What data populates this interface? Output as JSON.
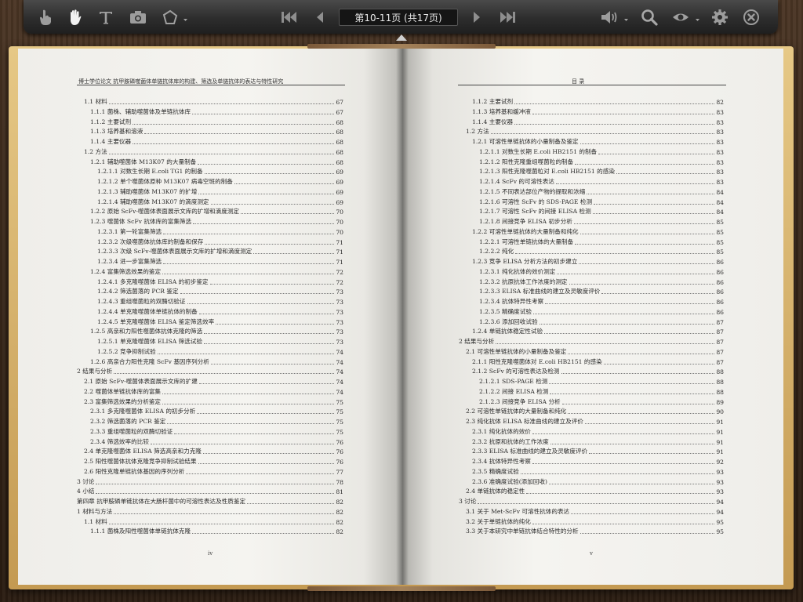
{
  "toolbar": {
    "page_indicator": "第10-11页 (共17页)",
    "tools": [
      {
        "name": "pointer-icon"
      },
      {
        "name": "hand-icon"
      },
      {
        "name": "text-icon"
      },
      {
        "name": "camera-icon"
      },
      {
        "name": "shape-icon"
      },
      {
        "name": "first-page-icon"
      },
      {
        "name": "prev-page-icon"
      },
      {
        "name": "next-page-icon"
      },
      {
        "name": "last-page-icon"
      },
      {
        "name": "volume-icon"
      },
      {
        "name": "search-icon"
      },
      {
        "name": "eye-icon"
      },
      {
        "name": "gear-icon"
      },
      {
        "name": "close-icon"
      }
    ]
  },
  "left_page": {
    "header": "博士学位论文 抗甲胺磷噬菌体单链抗体库的构建、筛选及单链抗体的表达与特性研究",
    "folio": "iv",
    "entries": [
      {
        "level": 2,
        "text": "1.1 材料",
        "page": "67"
      },
      {
        "level": 3,
        "text": "1.1.1 菌株、辅助噬菌体及单链抗体库",
        "page": "67"
      },
      {
        "level": 3,
        "text": "1.1.2 主要试剂",
        "page": "68"
      },
      {
        "level": 3,
        "text": "1.1.3 培养基和溶液",
        "page": "68"
      },
      {
        "level": 3,
        "text": "1.1.4 主要仪器",
        "page": "68"
      },
      {
        "level": 2,
        "text": "1.2 方法",
        "page": "68"
      },
      {
        "level": 3,
        "text": "1.2.1 辅助噬菌体 M13K07 的大量制备",
        "page": "68"
      },
      {
        "level": 4,
        "text": "1.2.1.1 对数生长期 E.coli TG1 的制备",
        "page": "69"
      },
      {
        "level": 4,
        "text": "1.2.1.2 单个噬菌体原种 M13K07 病毒空斑的制备",
        "page": "69"
      },
      {
        "level": 4,
        "text": "1.2.1.3 辅助噬菌体 M13K07 的扩增",
        "page": "69"
      },
      {
        "level": 4,
        "text": "1.2.1.4 辅助噬菌体 M13K07 的滴度测定",
        "page": "69"
      },
      {
        "level": 3,
        "text": "1.2.2 原始 ScFv-噬菌体表面展示文库的扩增和滴度测定",
        "page": "70"
      },
      {
        "level": 3,
        "text": "1.2.3 噬菌体 ScFv 抗体库的富集筛选",
        "page": "70"
      },
      {
        "level": 4,
        "text": "1.2.3.1 第一轮富集筛选",
        "page": "70"
      },
      {
        "level": 4,
        "text": "1.2.3.2 次级噬菌体抗体库的制备和保存",
        "page": "71"
      },
      {
        "level": 4,
        "text": "1.2.3.3 次级 ScFv-噬菌体表面展示文库的扩增和滴度测定",
        "page": "71"
      },
      {
        "level": 4,
        "text": "1.2.3.4 进一步富集筛选",
        "page": "71"
      },
      {
        "level": 3,
        "text": "1.2.4 富集筛选效果的鉴定",
        "page": "72"
      },
      {
        "level": 4,
        "text": "1.2.4.1 多克隆噬菌体 ELISA 的初步鉴定",
        "page": "72"
      },
      {
        "level": 4,
        "text": "1.2.4.2 筛选菌落的 PCR 鉴定",
        "page": "73"
      },
      {
        "level": 4,
        "text": "1.2.4.3 重组噬菌粒的双酶切验证",
        "page": "73"
      },
      {
        "level": 4,
        "text": "1.2.4.4 单克隆噬菌体单链抗体的制备",
        "page": "73"
      },
      {
        "level": 4,
        "text": "1.2.4.5 单克隆噬菌体 ELISA 鉴定筛选效率",
        "page": "73"
      },
      {
        "level": 3,
        "text": "1.2.5 高亲和力阳性噬菌体抗体克隆的筛选",
        "page": "73"
      },
      {
        "level": 4,
        "text": "1.2.5.1 单克隆噬菌体 ELISA 筛选试验",
        "page": "73"
      },
      {
        "level": 4,
        "text": "1.2.5.2 竞争抑制试验",
        "page": "74"
      },
      {
        "level": 3,
        "text": "1.2.6 高亲合力阳性克隆 ScFv 基因序列分析",
        "page": "74"
      },
      {
        "level": 1,
        "text": "2 结果与分析",
        "page": "74"
      },
      {
        "level": 2,
        "text": "2.1 原始 ScFv-噬菌体表面展示文库的扩建",
        "page": "74"
      },
      {
        "level": 2,
        "text": "2.2 噬菌体单链抗体库的富集",
        "page": "74"
      },
      {
        "level": 2,
        "text": "2.3 富集筛选效果的分析鉴定",
        "page": "75"
      },
      {
        "level": 3,
        "text": "2.3.1 多克隆噬菌体 ELISA 的初步分析",
        "page": "75"
      },
      {
        "level": 3,
        "text": "2.3.2 筛选菌落的 PCR 鉴定",
        "page": "75"
      },
      {
        "level": 3,
        "text": "2.3.3 重组噬菌粒的双酶切验证",
        "page": "75"
      },
      {
        "level": 3,
        "text": "2.3.4 筛选效率的比较",
        "page": "76"
      },
      {
        "level": 2,
        "text": "2.4 单克隆噬菌体 ELISA 筛选高亲和力克隆",
        "page": "76"
      },
      {
        "level": 2,
        "text": "2.5 阳性噬菌体抗体克隆竞争抑制试验结果",
        "page": "76"
      },
      {
        "level": 2,
        "text": "2.6 阳性克隆单链抗体基因的序列分析",
        "page": "77"
      },
      {
        "level": 1,
        "text": "3 讨论",
        "page": "78"
      },
      {
        "level": 1,
        "text": "4 小结",
        "page": "81"
      },
      {
        "level": 0,
        "text": "第四章 抗甲胺磷单链抗体在大肠杆菌中的可溶性表达及性质鉴定",
        "page": "82"
      },
      {
        "level": 1,
        "text": "1 材料与方法",
        "page": "82"
      },
      {
        "level": 2,
        "text": "1.1 材料",
        "page": "82"
      },
      {
        "level": 3,
        "text": "1.1.1 菌株及阳性噬菌体单链抗体克隆",
        "page": "82"
      }
    ]
  },
  "right_page": {
    "header": "目 录",
    "folio": "v",
    "entries": [
      {
        "level": 3,
        "text": "1.1.2 主要试剂",
        "page": "82"
      },
      {
        "level": 3,
        "text": "1.1.3 培养基和缓冲液",
        "page": "83"
      },
      {
        "level": 3,
        "text": "1.1.4 主要仪器",
        "page": "83"
      },
      {
        "level": 2,
        "text": "1.2 方法",
        "page": "83"
      },
      {
        "level": 3,
        "text": "1.2.1 可溶性单链抗体的小量制备及鉴定",
        "page": "83"
      },
      {
        "level": 4,
        "text": "1.2.1.1 对数生长期 E.coli HB2151 的制备",
        "page": "83"
      },
      {
        "level": 4,
        "text": "1.2.1.2 阳性克隆重组噬菌粒的制备",
        "page": "83"
      },
      {
        "level": 4,
        "text": "1.2.1.3 阳性克隆噬菌粒对 E.coli HB2151 的感染",
        "page": "83"
      },
      {
        "level": 4,
        "text": "1.2.1.4 SсFv 的可溶性表达",
        "page": "83"
      },
      {
        "level": 4,
        "text": "1.2.1.5 不同表达部位产物的提取和浓缩",
        "page": "84"
      },
      {
        "level": 4,
        "text": "1.2.1.6 可溶性 SсFv 的 SDS-PAGE 检测",
        "page": "84"
      },
      {
        "level": 4,
        "text": "1.2.1.7 可溶性 ScFv 的间接 ELISA 检测",
        "page": "84"
      },
      {
        "level": 4,
        "text": "1.2.1.8 间接竞争 ELISA 初步分析",
        "page": "85"
      },
      {
        "level": 3,
        "text": "1.2.2 可溶性单链抗体的大量制备和纯化",
        "page": "85"
      },
      {
        "level": 4,
        "text": "1.2.2.1 可溶性单链抗体的大量制备",
        "page": "85"
      },
      {
        "level": 4,
        "text": "1.2.2.2 纯化",
        "page": "85"
      },
      {
        "level": 3,
        "text": "1.2.3 竞争 ELISA 分析方法的初步建立",
        "page": "86"
      },
      {
        "level": 4,
        "text": "1.2.3.1 纯化抗体的效价测定",
        "page": "86"
      },
      {
        "level": 4,
        "text": "1.2.3.2 抗原抗体工作浓度的测定",
        "page": "86"
      },
      {
        "level": 4,
        "text": "1.2.3.3 ELISA 标准曲线的建立及灵敏度评价",
        "page": "86"
      },
      {
        "level": 4,
        "text": "1.2.3.4 抗体特异性考察",
        "page": "86"
      },
      {
        "level": 4,
        "text": "1.2.3.5 精确度试验",
        "page": "86"
      },
      {
        "level": 4,
        "text": "1.2.3.6 添加回收试验",
        "page": "87"
      },
      {
        "level": 3,
        "text": "1.2.4 单链抗体稳定性试验",
        "page": "87"
      },
      {
        "level": 1,
        "text": "2 结果与分析",
        "page": "87"
      },
      {
        "level": 2,
        "text": "2.1 可溶性单链抗体的小量制备及鉴定",
        "page": "87"
      },
      {
        "level": 3,
        "text": "2.1.1 阳性克隆噬菌体对 E.coli HB2151 的感染",
        "page": "87"
      },
      {
        "level": 3,
        "text": "2.1.2 ScFv 的可溶性表达及检测",
        "page": "88"
      },
      {
        "level": 4,
        "text": "2.1.2.1 SDS-PAGE 检测",
        "page": "88"
      },
      {
        "level": 4,
        "text": "2.1.2.2 间接 ELISA 检测",
        "page": "88"
      },
      {
        "level": 4,
        "text": "2.1.2.3 间接竞争 ELISA 分析",
        "page": "89"
      },
      {
        "level": 2,
        "text": "2.2 可溶性单链抗体的大量制备和纯化",
        "page": "90"
      },
      {
        "level": 2,
        "text": "2.3 纯化抗体 ELISA 标准曲线的建立及评价",
        "page": "91"
      },
      {
        "level": 3,
        "text": "2.3.1 纯化抗体的效价",
        "page": "91"
      },
      {
        "level": 3,
        "text": "2.3.2 抗原和抗体的工作浓度",
        "page": "91"
      },
      {
        "level": 3,
        "text": "2.3.3 ELISA 标准曲线的建立及灵敏度评价",
        "page": "91"
      },
      {
        "level": 3,
        "text": "2.3.4 抗体特异性考察",
        "page": "92"
      },
      {
        "level": 3,
        "text": "2.3.5 精确度试验",
        "page": "93"
      },
      {
        "level": 3,
        "text": "2.3.6 准确度试验(添加回收)",
        "page": "93"
      },
      {
        "level": 2,
        "text": "2.4 单链抗体的稳定性",
        "page": "93"
      },
      {
        "level": 1,
        "text": "3 讨论",
        "page": "94"
      },
      {
        "level": 2,
        "text": "3.1 关于 Met-ScFv 可溶性抗体的表达",
        "page": "94"
      },
      {
        "level": 2,
        "text": "3.2 关于单链抗体的纯化",
        "page": "95"
      },
      {
        "level": 2,
        "text": "3.3 关于本研究中单链抗体结合特性的分析",
        "page": "95"
      }
    ]
  }
}
